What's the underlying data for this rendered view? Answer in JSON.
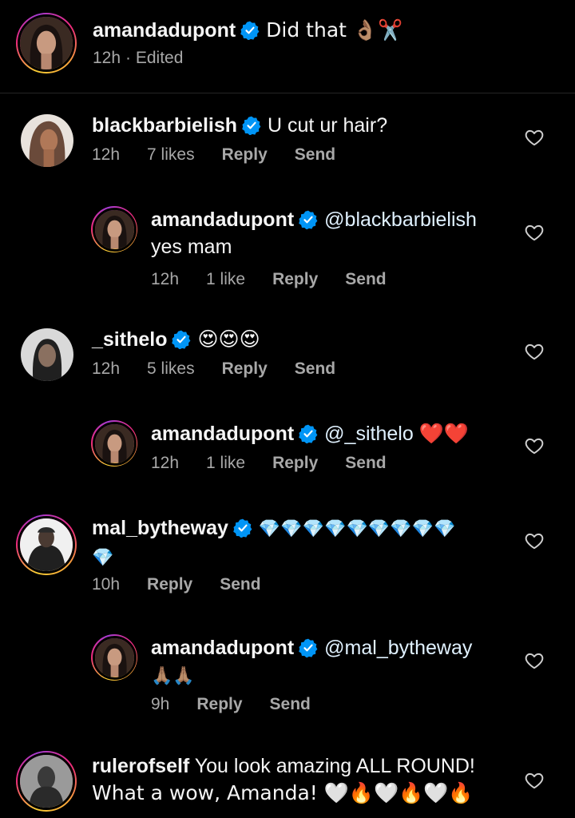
{
  "caption": {
    "username": "amandadupont",
    "text": "Did that 👌🏽✂️",
    "time": "12h",
    "edited": "· Edited"
  },
  "comments": [
    {
      "username": "blackbarbielish",
      "text": "U cut ur hair?",
      "time": "12h",
      "likes": "7 likes",
      "reply": "Reply",
      "send": "Send",
      "replies": [
        {
          "username": "amandadupont",
          "mention": "@blackbarbielish",
          "text": "yes mam",
          "time": "12h",
          "likes": "1 like",
          "reply": "Reply",
          "send": "Send"
        }
      ]
    },
    {
      "username": "_sithelo",
      "text": "😍😍😍",
      "time": "12h",
      "likes": "5 likes",
      "reply": "Reply",
      "send": "Send",
      "replies": [
        {
          "username": "amandadupont",
          "mention": "@_sithelo",
          "text": "❤️❤️",
          "time": "12h",
          "likes": "1 like",
          "reply": "Reply",
          "send": "Send"
        }
      ]
    },
    {
      "username": "mal_bytheway",
      "text": "💎💎💎💎💎💎💎💎💎",
      "text2": "💎",
      "time": "10h",
      "reply": "Reply",
      "send": "Send",
      "replies": [
        {
          "username": "amandadupont",
          "mention": "@mal_bytheway",
          "text": "🙏🏽🙏🏽",
          "time": "9h",
          "reply": "Reply",
          "send": "Send"
        }
      ]
    },
    {
      "username": "rulerofself",
      "text": "You look amazing ALL ROUND!",
      "text2": "What a wow, Amanda! 🤍🔥🤍🔥🤍🔥"
    }
  ],
  "icons": {
    "verified": "verified-badge-icon",
    "heart": "heart-outline-icon"
  },
  "colors": {
    "background": "#000000",
    "verified": "#0095f6",
    "secondary_text": "#a8a8a8"
  }
}
